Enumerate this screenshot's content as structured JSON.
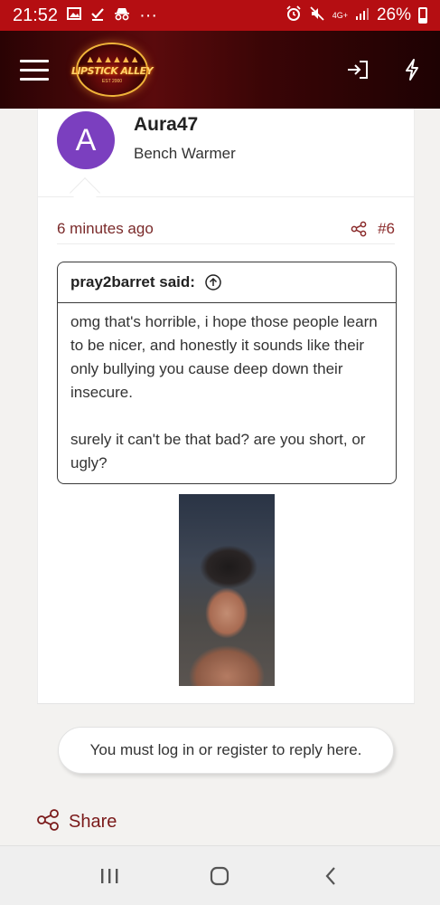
{
  "status_bar": {
    "time": "21:52",
    "ellipsis": "···",
    "network": "4G+",
    "battery": "26%"
  },
  "header": {
    "logo_text": "LIPSTICK ALLEY",
    "logo_sub": "EST 2000",
    "icons": [
      "menu-icon",
      "login-icon",
      "lightning-icon"
    ]
  },
  "post": {
    "avatar_letter": "A",
    "avatar_color": "#7b3fbf",
    "username": "Aura47",
    "user_title": "Bench Warmer",
    "time": "6 minutes ago",
    "post_number": "#6",
    "quote": {
      "author": "pray2barret said:",
      "paragraphs": [
        "omg that's horrible, i hope those people learn to be nicer, and honestly it sounds like their only bullying you cause deep down their insecure.",
        "surely it can't be that bad? are you short, or ugly?"
      ]
    }
  },
  "reply_prompt": "You must log in or register to reply here.",
  "share_label": "Share",
  "colors": {
    "status_bar": "#b50e12",
    "accent": "#7a1a1a"
  }
}
